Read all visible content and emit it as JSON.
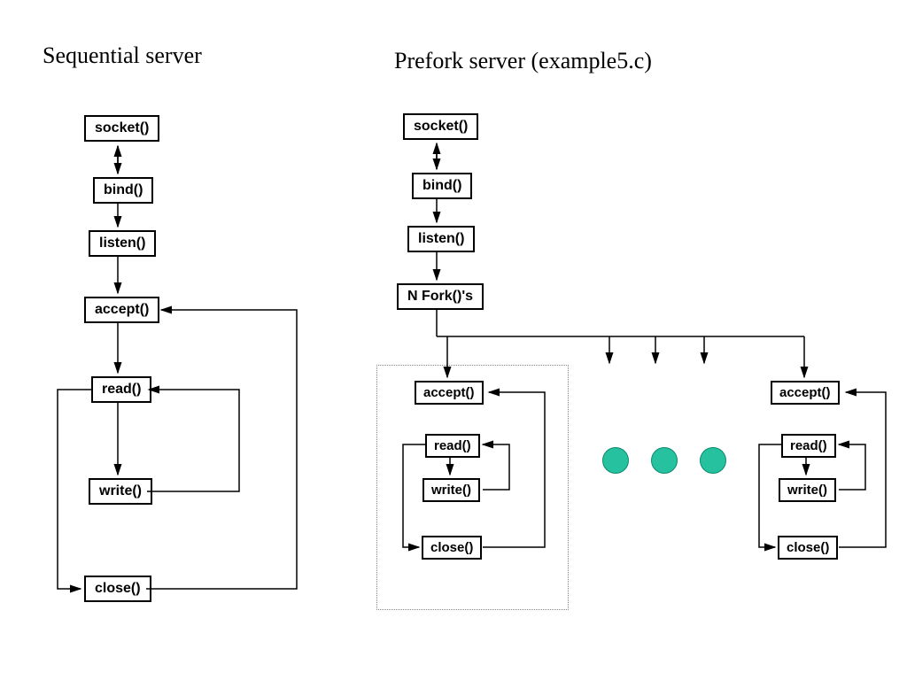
{
  "titles": {
    "left": "Sequential server",
    "right": "Prefork server (example5.c)"
  },
  "seq": {
    "socket": "socket()",
    "bind": "bind()",
    "listen": "listen()",
    "accept": "accept()",
    "read": "read()",
    "write": "write()",
    "close": "close()"
  },
  "pre": {
    "socket": "socket()",
    "bind": "bind()",
    "listen": "listen()",
    "nfork": "N Fork()'s",
    "accept": "accept()",
    "read": "read()",
    "write": "write()",
    "close": "close()"
  }
}
